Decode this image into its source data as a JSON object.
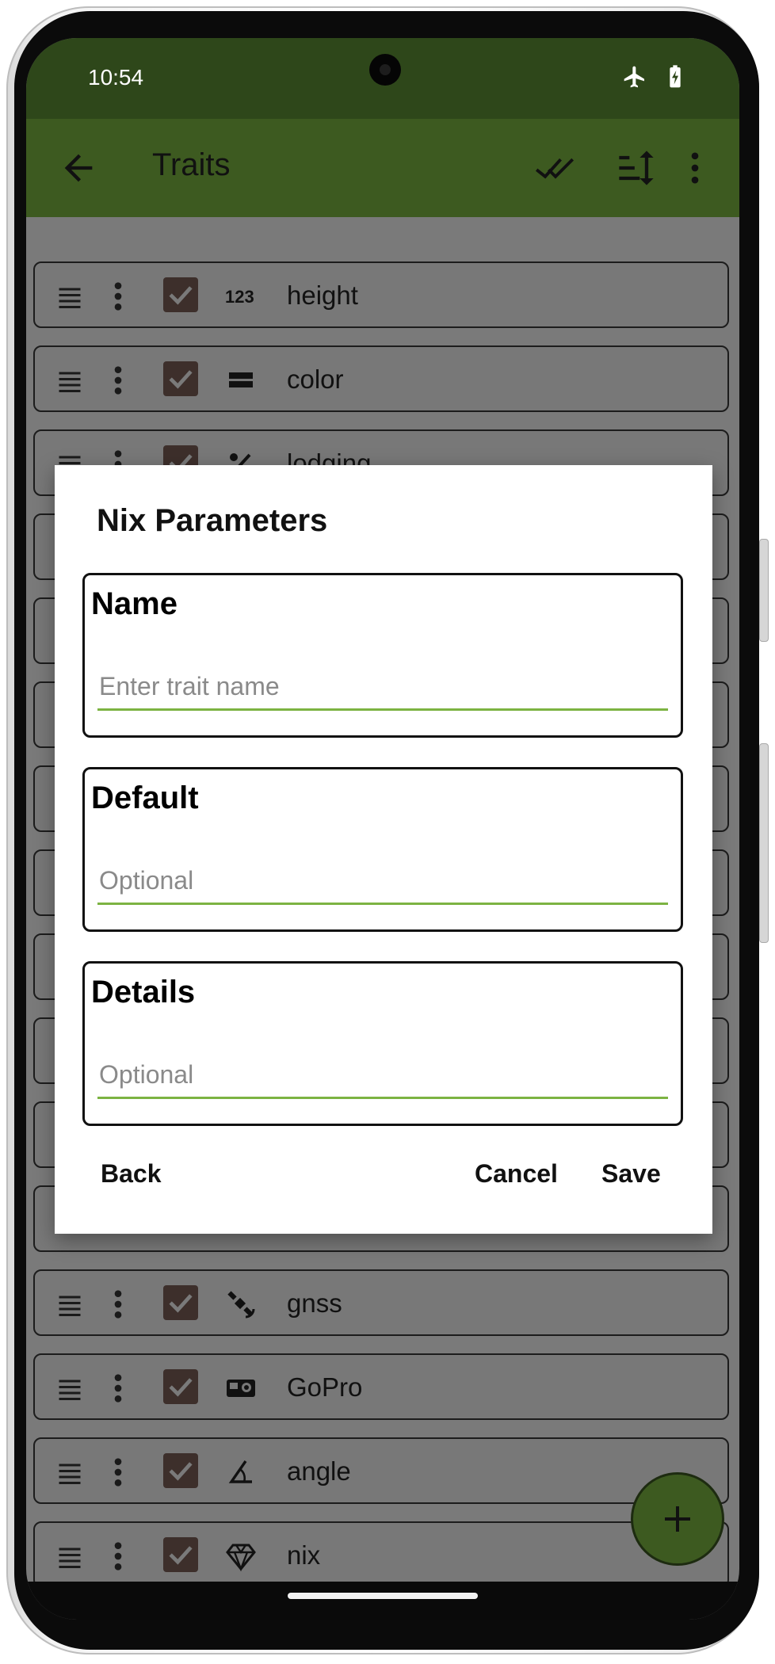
{
  "status_bar": {
    "time": "10:54",
    "icons": [
      "airplane-mode-icon",
      "battery-charging-icon"
    ]
  },
  "toolbar": {
    "title": "Traits",
    "icons": [
      "back-arrow-icon",
      "check-all-icon",
      "sort-icon",
      "more-vert-icon"
    ]
  },
  "traits": [
    {
      "label": "height",
      "icon": "numeric-icon",
      "checked": true
    },
    {
      "label": "color",
      "icon": "categorical-icon",
      "checked": true
    },
    {
      "label": "lodging",
      "icon": "percent-icon",
      "checked": true
    },
    {
      "label": "gnss",
      "icon": "satellite-icon",
      "checked": true
    },
    {
      "label": "GoPro",
      "icon": "camera-icon",
      "checked": true
    },
    {
      "label": "angle",
      "icon": "angle-icon",
      "checked": true
    },
    {
      "label": "nix",
      "icon": "gem-icon",
      "checked": true
    }
  ],
  "dialog": {
    "title": "Nix Parameters",
    "fields": [
      {
        "label": "Name",
        "placeholder": "Enter trait name",
        "value": ""
      },
      {
        "label": "Default",
        "placeholder": "Optional",
        "value": ""
      },
      {
        "label": "Details",
        "placeholder": "Optional",
        "value": ""
      }
    ],
    "buttons": {
      "back": "Back",
      "cancel": "Cancel",
      "save": "Save"
    }
  },
  "fab": {
    "icon": "plus-icon"
  },
  "colors": {
    "status_bar": "#2e471a",
    "toolbar": "#3d5a20",
    "scrim_background": "#7a7a7a",
    "input_underline": "#7cb342",
    "checkbox": "#3d2f2b"
  }
}
